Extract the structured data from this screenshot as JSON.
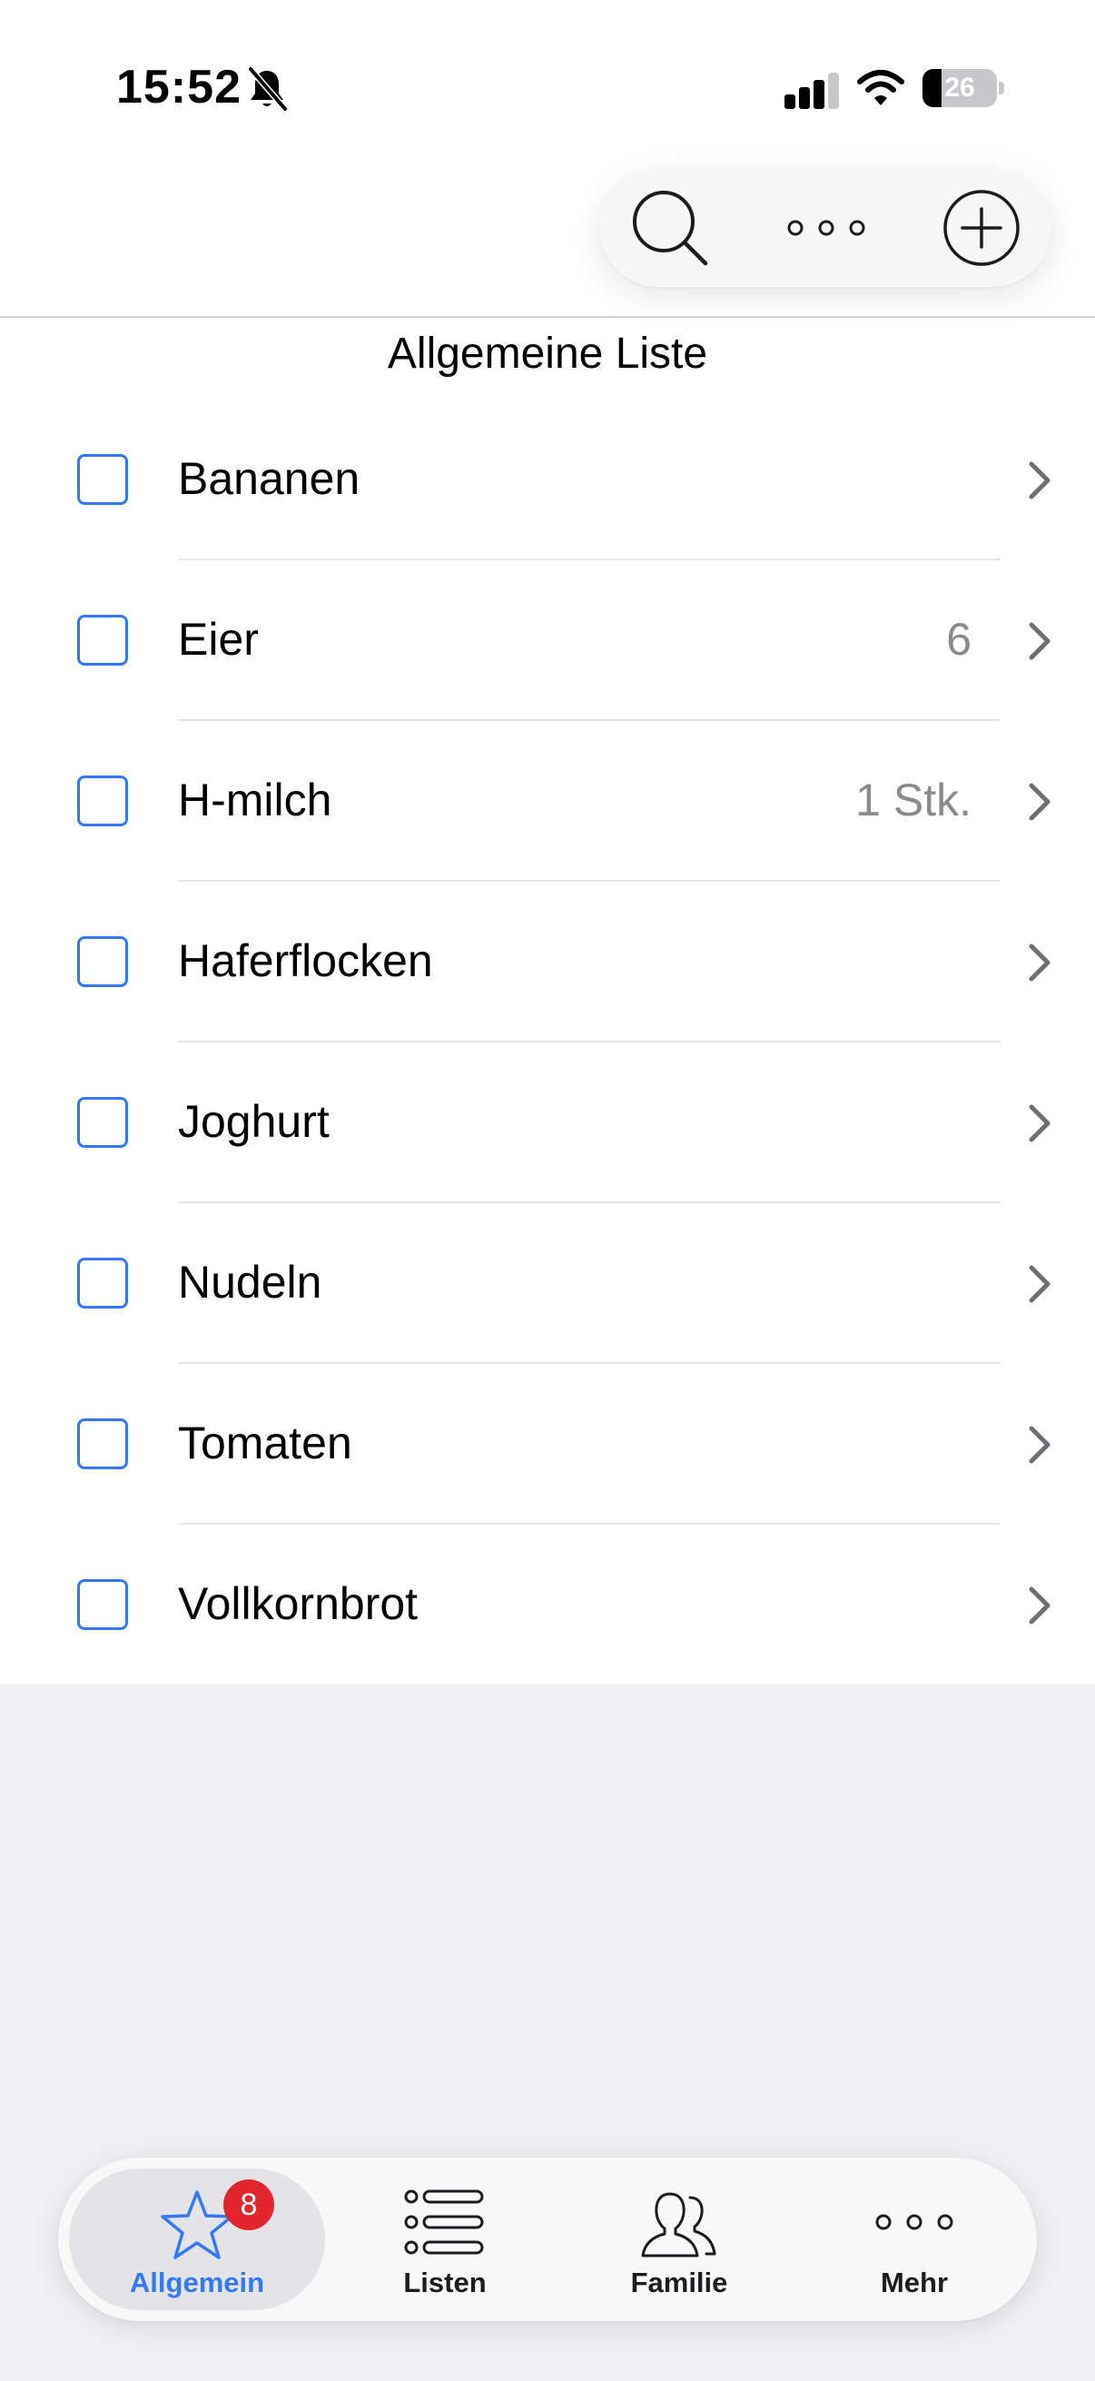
{
  "status_bar": {
    "time": "15:52",
    "battery_level": "26",
    "battery_fraction": 0.26,
    "icons": [
      "bell-slash-icon",
      "cellular-signal-icon",
      "wifi-icon",
      "battery-icon"
    ]
  },
  "toolbar": {
    "icons": [
      "search-icon",
      "ellipsis-icon",
      "plus-circle-icon"
    ]
  },
  "list": {
    "title": "Allgemeine Liste",
    "items": [
      {
        "name": "Bananen",
        "quantity": ""
      },
      {
        "name": "Eier",
        "quantity": "6"
      },
      {
        "name": "H-milch",
        "quantity": "1 Stk."
      },
      {
        "name": "Haferflocken",
        "quantity": ""
      },
      {
        "name": "Joghurt",
        "quantity": ""
      },
      {
        "name": "Nudeln",
        "quantity": ""
      },
      {
        "name": "Tomaten",
        "quantity": ""
      },
      {
        "name": "Vollkornbrot",
        "quantity": ""
      }
    ]
  },
  "tabbar": {
    "tabs": [
      {
        "label": "Allgemein",
        "icon": "star-icon",
        "badge": "8",
        "active": true
      },
      {
        "label": "Listen",
        "icon": "list-bullet-icon",
        "active": false
      },
      {
        "label": "Familie",
        "icon": "people-icon",
        "active": false
      },
      {
        "label": "Mehr",
        "icon": "ellipsis-icon",
        "active": false
      }
    ]
  },
  "colors": {
    "accent": "#3478f6",
    "badge": "#e3262e",
    "background": "#efeff4",
    "secondary_text": "#8a8a8e"
  }
}
